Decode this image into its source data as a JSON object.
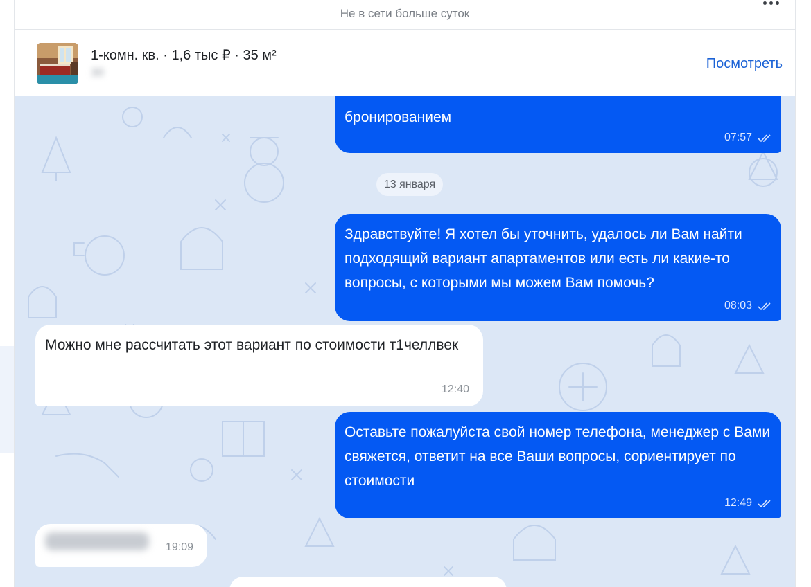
{
  "header": {
    "status": "Не в сети больше суток",
    "more_icon": "more-dots-icon"
  },
  "listing": {
    "title": "1-комн. кв. · 1,6 тыс ₽ · 35 м²",
    "address_blurred": "30",
    "view_label": "Посмотреть"
  },
  "chat": {
    "messages": [
      {
        "direction": "outgoing",
        "text": "бронированием",
        "time": "07:57",
        "status": "read"
      },
      {
        "type": "date_separator",
        "label": "13 января"
      },
      {
        "direction": "outgoing",
        "text": "Здравствуйте! Я хотел бы уточнить, удалось ли Вам найти подходящий вариант апартаментов или есть ли какие-то вопросы, с которыми мы можем Вам помочь?",
        "time": "08:03",
        "status": "read"
      },
      {
        "direction": "incoming",
        "text": "Можно мне рассчитать этот вариант по стоимости т1челлвек",
        "time": "12:40"
      },
      {
        "direction": "outgoing",
        "text": "Оставьте пожалуйста свой номер телефона, менеджер с Вами свяжется, ответит на все Ваши вопросы, сориентирует по стоимости",
        "time": "12:49",
        "status": "read"
      },
      {
        "direction": "incoming",
        "text": "",
        "time": "19:09",
        "blurred": true
      }
    ]
  },
  "colors": {
    "outgoing_bubble": "#0459f3",
    "incoming_bubble": "#ffffff",
    "chat_background": "#dce7f6",
    "link": "#1c63d6"
  }
}
